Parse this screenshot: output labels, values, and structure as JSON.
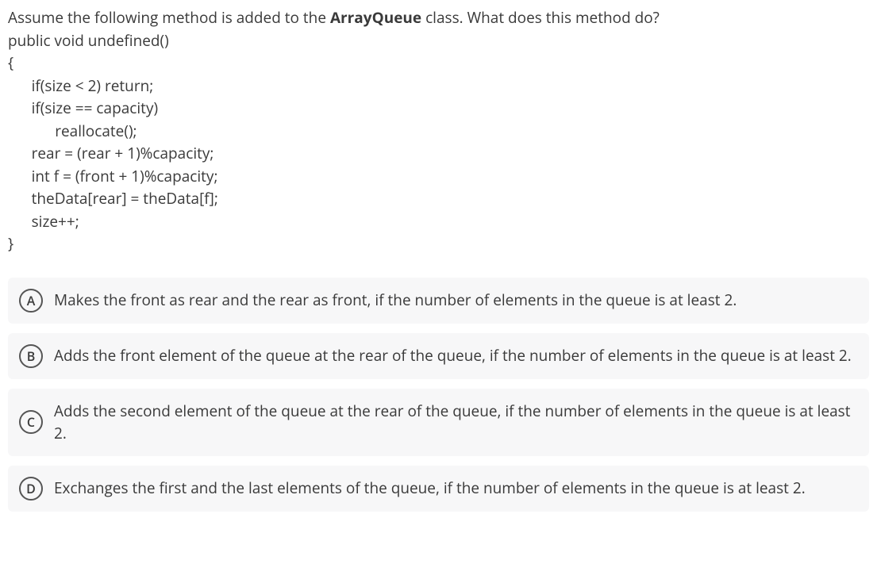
{
  "question": {
    "intro_pre": "Assume the following method is added to the ",
    "bold_class": "ArrayQueue",
    "intro_post": " class. What does this method do?",
    "code": "public void undefined()\n{\n      if(size < 2) return;\n      if(size == capacity)\n            reallocate();\n      rear = (rear + 1)%capacity;\n      int f = (front + 1)%capacity;\n      theData[rear] = theData[f];\n      size++;\n}"
  },
  "options": [
    {
      "letter": "A",
      "text": "Makes the front as rear and the rear as front, if the number of elements in the queue is at least 2."
    },
    {
      "letter": "B",
      "text": "Adds the front element of the queue at the rear of the queue, if the number of elements in the queue is at least 2."
    },
    {
      "letter": "C",
      "text": "Adds the second element of the queue at the rear of the queue, if the number of elements in the queue is at least 2."
    },
    {
      "letter": "D",
      "text": "Exchanges the first and the last elements of the queue, if the number of elements in the queue is at least 2."
    }
  ]
}
